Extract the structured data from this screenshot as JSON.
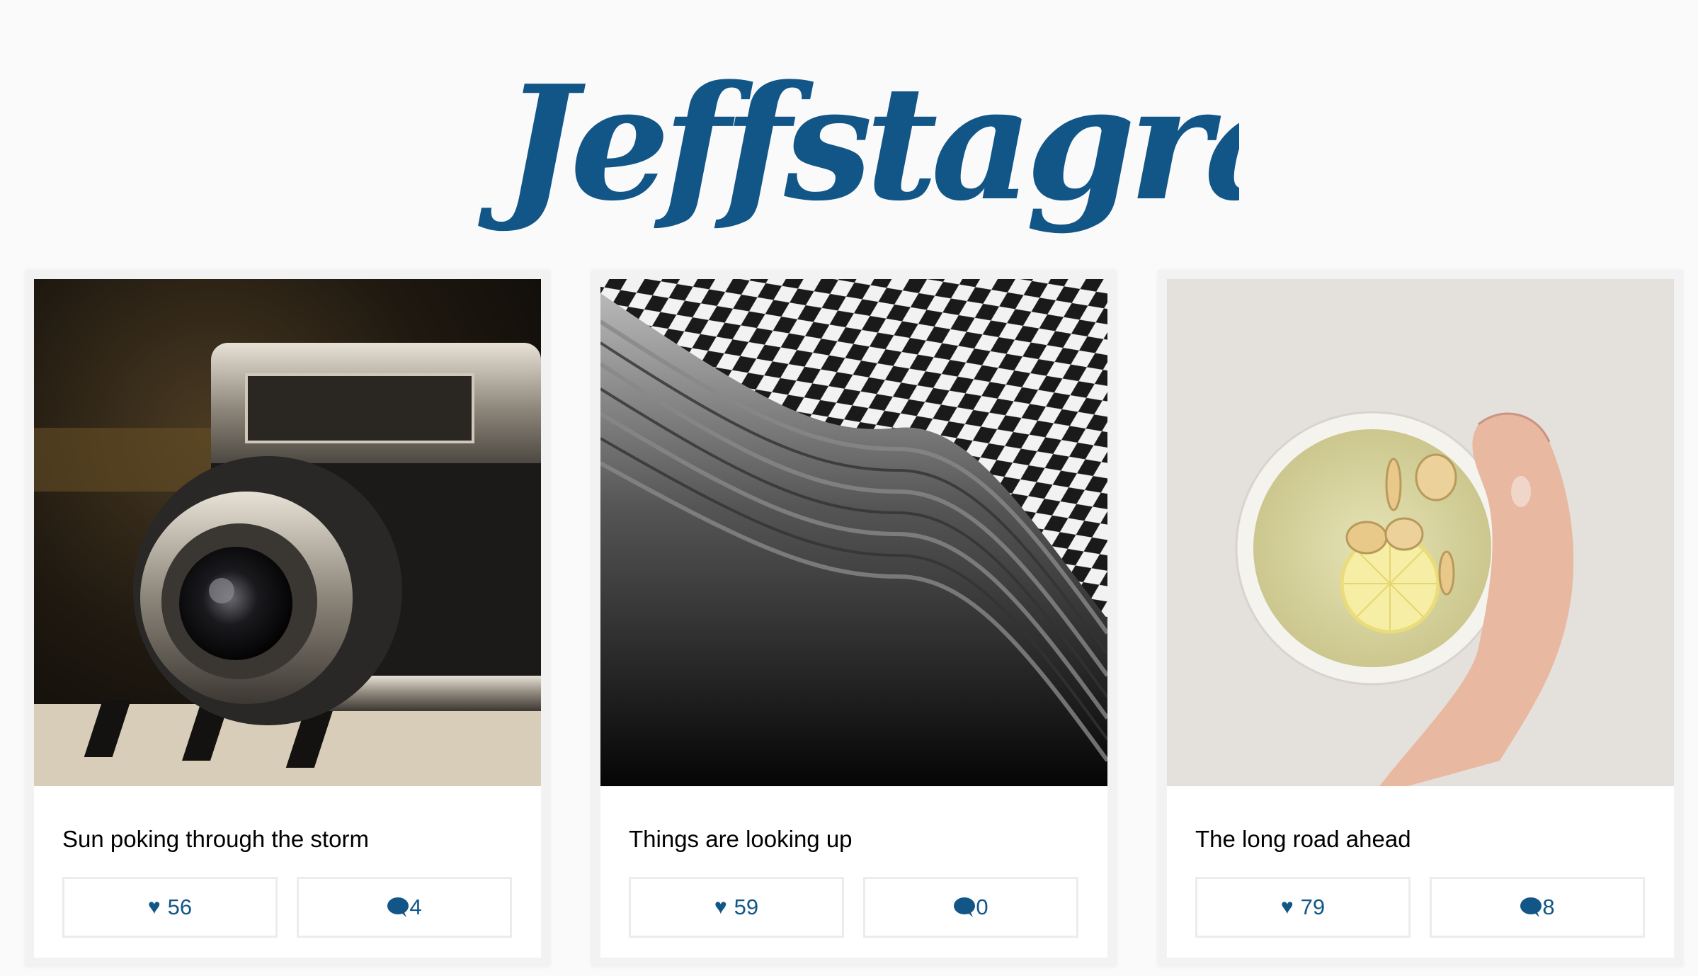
{
  "app": {
    "title": "Jeffstagram!",
    "accent_color": "#125688"
  },
  "posts": [
    {
      "caption": "Sun poking through the storm",
      "likes": "56",
      "comments": "4",
      "image": "vintage-camera-photo"
    },
    {
      "caption": "Things are looking up",
      "likes": "59",
      "comments": "0",
      "image": "abstract-architecture-photo"
    },
    {
      "caption": "The long road ahead",
      "likes": "79",
      "comments": "8",
      "image": "lemon-tea-cup-photo"
    }
  ],
  "icons": {
    "like": "heart-icon",
    "comment": "speech-bubble-icon"
  }
}
